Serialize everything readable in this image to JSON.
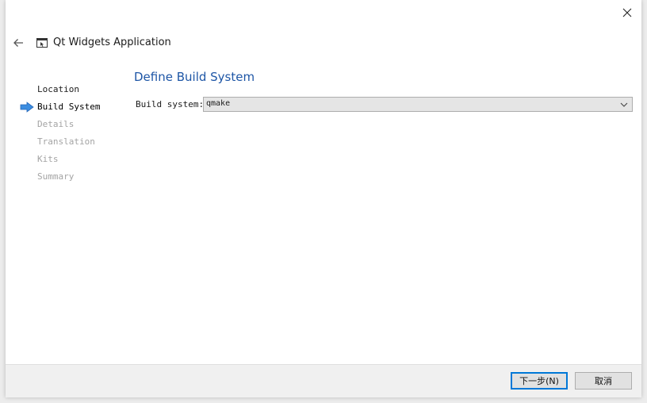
{
  "window": {
    "title": "Qt Widgets Application"
  },
  "steps": [
    {
      "label": "Location",
      "state": "done"
    },
    {
      "label": "Build System",
      "state": "current"
    },
    {
      "label": "Details",
      "state": "pending"
    },
    {
      "label": "Translation",
      "state": "pending"
    },
    {
      "label": "Kits",
      "state": "pending"
    },
    {
      "label": "Summary",
      "state": "pending"
    }
  ],
  "page": {
    "title": "Define Build System",
    "build_system": {
      "label": "Build system:",
      "value": "qmake"
    }
  },
  "buttons": {
    "next": "下一步(N)",
    "cancel": "取消"
  },
  "icons": {
    "close": "close-icon",
    "back": "back-arrow-icon",
    "app": "qt-widgets-window-icon",
    "current_step": "current-step-arrow-icon",
    "dropdown": "chevron-down-icon"
  },
  "colors": {
    "accent_title": "#1e56a6",
    "step_arrow": "#3c8de0",
    "primary_border": "#0078d7"
  }
}
